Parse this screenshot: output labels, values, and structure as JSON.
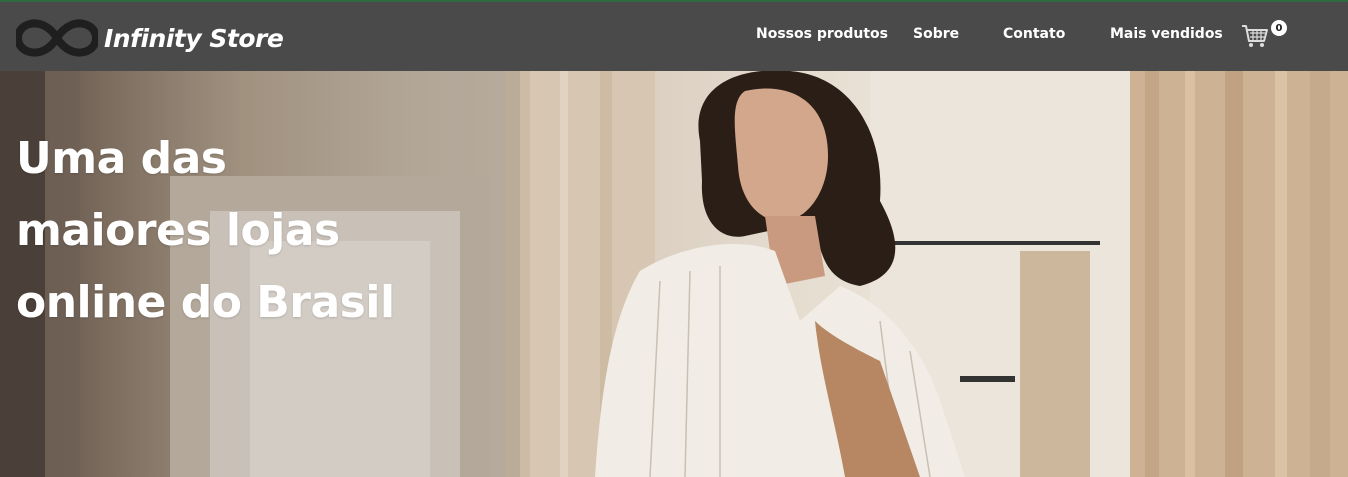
{
  "brand": {
    "name": "Infinity Store",
    "logo_icon": "infinity-icon"
  },
  "nav": {
    "items": [
      {
        "label": "Nossos produtos"
      },
      {
        "label": "Sobre"
      },
      {
        "label": "Contato"
      },
      {
        "label": "Mais vendidos"
      }
    ],
    "cart": {
      "icon": "cart-icon",
      "count": "0"
    }
  },
  "hero": {
    "title_lines": [
      "Uma das",
      "maiores lojas",
      "online do Brasil"
    ]
  },
  "colors": {
    "navbar": "#4a4a4a",
    "accent_line": "#2f6b3e",
    "text": "#ffffff"
  }
}
